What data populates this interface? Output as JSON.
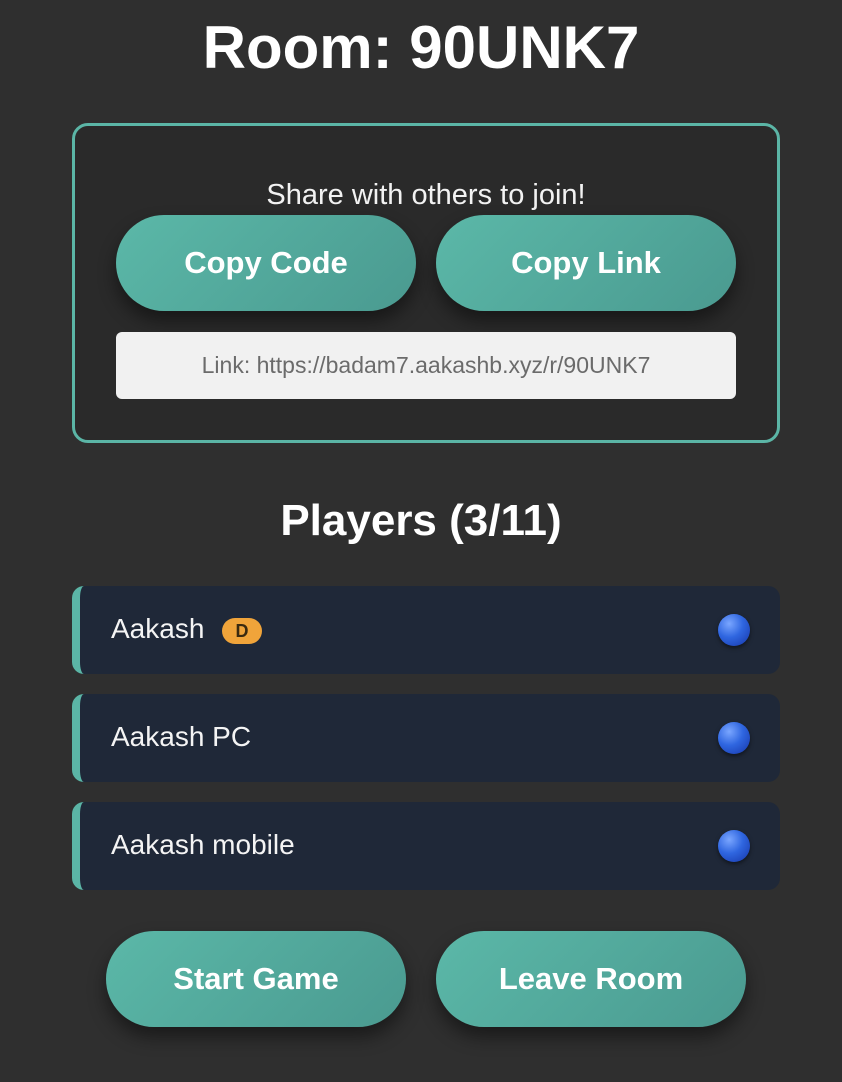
{
  "room": {
    "title": "Room: 90UNK7"
  },
  "share": {
    "prompt": "Share with others to join!",
    "copy_code_label": "Copy Code",
    "copy_link_label": "Copy Link",
    "link_text": "Link: https://badam7.aakashb.xyz/r/90UNK7"
  },
  "players": {
    "heading": "Players (3/11)",
    "list": [
      {
        "name": "Aakash",
        "badge": "D",
        "status_icon": "online-dot-icon"
      },
      {
        "name": "Aakash PC",
        "status_icon": "online-dot-icon"
      },
      {
        "name": "Aakash mobile",
        "status_icon": "online-dot-icon"
      }
    ]
  },
  "actions": {
    "start_label": "Start Game",
    "leave_label": "Leave Room"
  },
  "colors": {
    "accent": "#5bb5a6",
    "background": "#232323",
    "player_row": "#1f2838",
    "badge": "#f0a43a",
    "status_dot": "#2f66e0"
  }
}
